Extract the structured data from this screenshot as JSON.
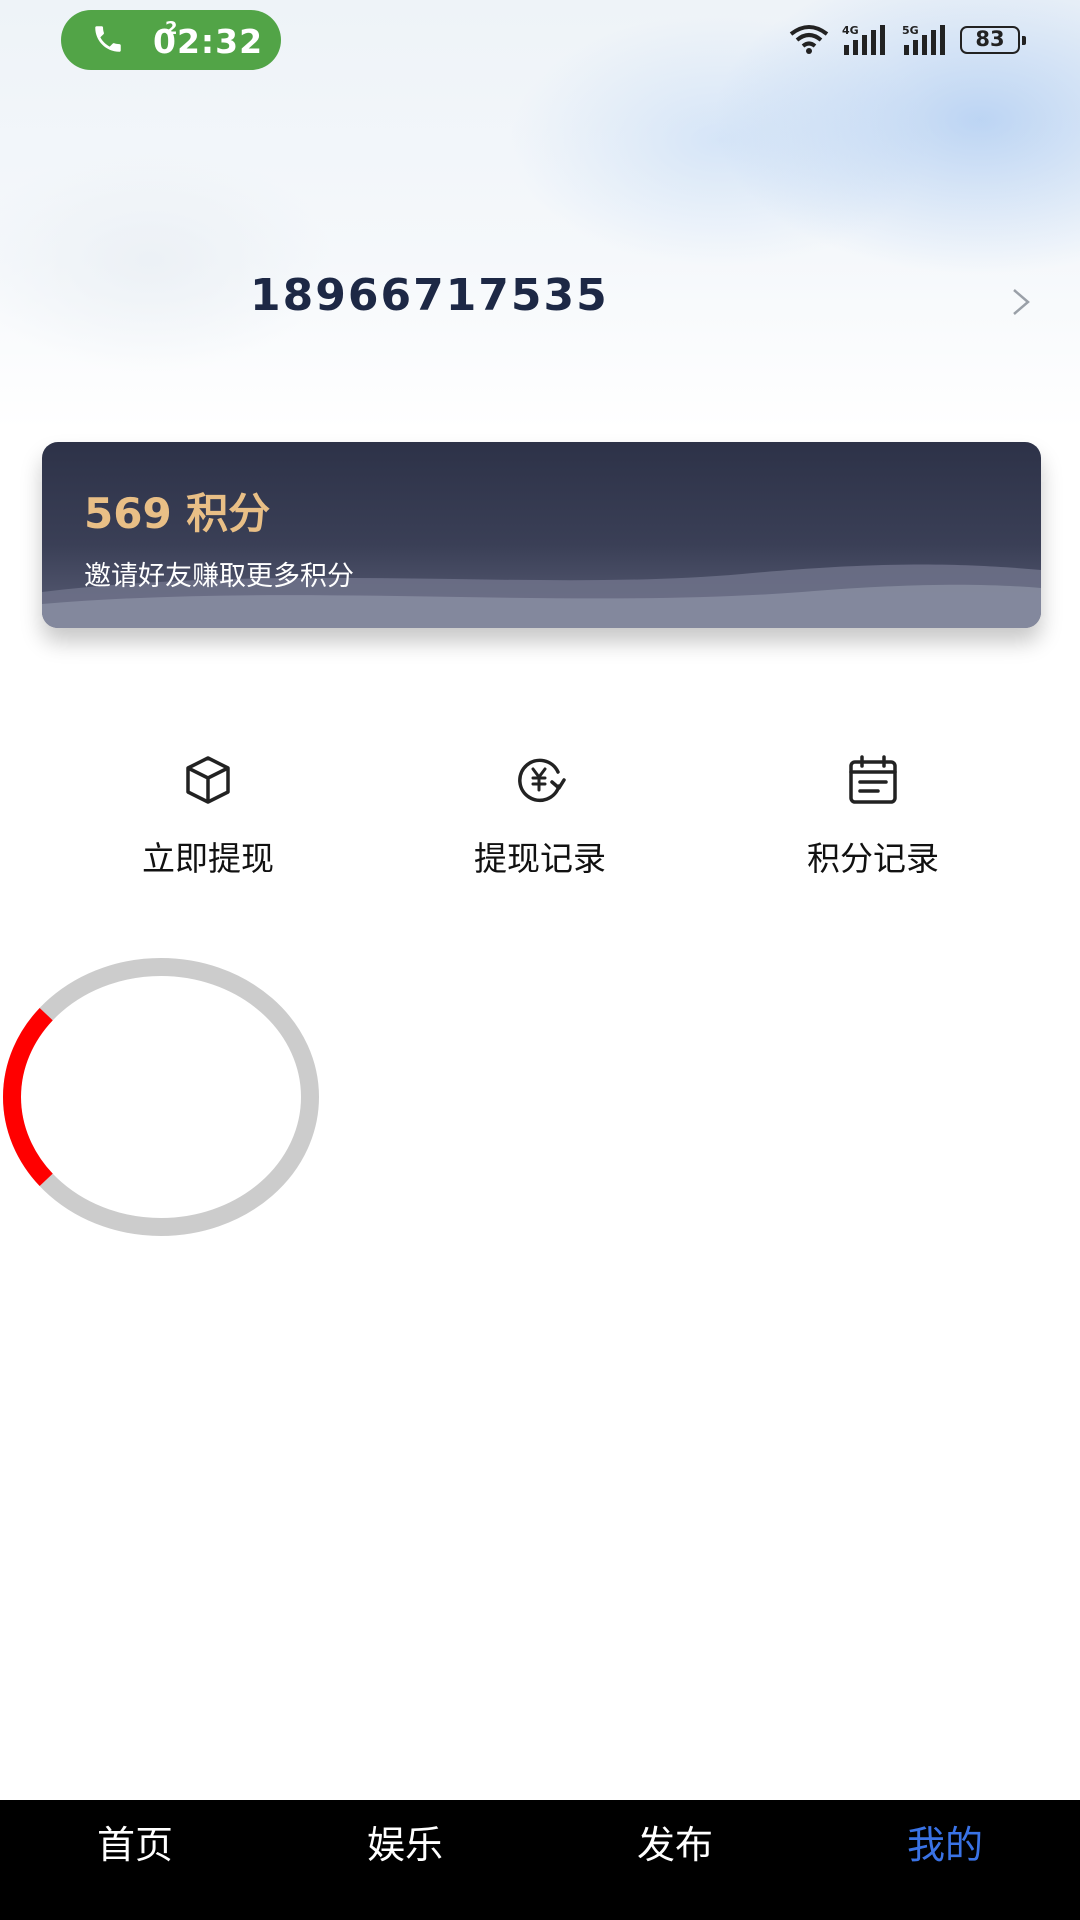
{
  "status_bar": {
    "call_badge": "2",
    "time": "02:32",
    "battery": "83",
    "icons": [
      "phone-icon",
      "wifi-icon",
      "signal-4g-icon",
      "signal-5g-icon",
      "battery-icon"
    ]
  },
  "profile": {
    "phone_number": "18966717535"
  },
  "points_card": {
    "value": "569 积分",
    "subtitle": "邀请好友赚取更多积分"
  },
  "actions": [
    {
      "label": "立即提现",
      "icon": "box-icon"
    },
    {
      "label": "提现记录",
      "icon": "yuan-refresh-icon"
    },
    {
      "label": "积分记录",
      "icon": "calendar-icon"
    }
  ],
  "loader": {
    "progress": 0.22,
    "color": "#ff0000",
    "track_color": "#cccccc"
  },
  "bottom_nav": {
    "items": [
      {
        "label": "首页"
      },
      {
        "label": "娱乐"
      },
      {
        "label": "发布"
      },
      {
        "label": "我的"
      }
    ],
    "active_index": 3,
    "active_color": "#3a73e6"
  }
}
